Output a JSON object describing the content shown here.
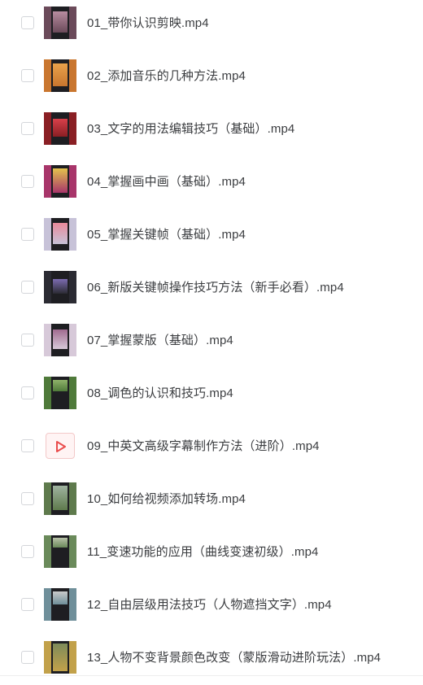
{
  "files": [
    {
      "name": "01_带你认识剪映.mp4",
      "icon": "video-thumbnail",
      "thumb_colors": [
        "#6b4a5a",
        "#b78ca0",
        "#2a1f28"
      ]
    },
    {
      "name": "02_添加音乐的几种方法.mp4",
      "icon": "video-thumbnail",
      "thumb_colors": [
        "#c9762f",
        "#e9a24b",
        "#7a3a1c"
      ]
    },
    {
      "name": "03_文字的用法编辑技巧（基础）.mp4",
      "icon": "video-thumbnail",
      "thumb_colors": [
        "#8a1f24",
        "#d8404a",
        "#222222"
      ]
    },
    {
      "name": "04_掌握画中画（基础）.mp4",
      "icon": "video-thumbnail",
      "thumb_colors": [
        "#a8356a",
        "#e4c24c",
        "#2a2a2a"
      ]
    },
    {
      "name": "05_掌握关键帧（基础）.mp4",
      "icon": "video-thumbnail",
      "thumb_colors": [
        "#c7c2d8",
        "#e98a9b",
        "#3c3c48"
      ]
    },
    {
      "name": "06_新版关键帧操作技巧方法（新手必看）.mp4",
      "icon": "video-thumbnail",
      "thumb_colors": [
        "#2b2b33",
        "#7c6bb0",
        "#111114"
      ]
    },
    {
      "name": "07_掌握蒙版（基础）.mp4",
      "icon": "video-thumbnail",
      "thumb_colors": [
        "#d7c9d9",
        "#a06a8f",
        "#1c1c1c"
      ]
    },
    {
      "name": "08_调色的认识和技巧.mp4",
      "icon": "video-thumbnail",
      "thumb_colors": [
        "#4f7a3a",
        "#8fb26a",
        "#1a1a1a"
      ]
    },
    {
      "name": "09_中英文高级字幕制作方法（进阶）.mp4",
      "icon": "video-file-icon",
      "thumb_colors": [
        "#fff4f4",
        "#ea4d4d",
        "#f3c9c9"
      ]
    },
    {
      "name": "10_如何给视频添加转场.mp4",
      "icon": "video-thumbnail",
      "thumb_colors": [
        "#5e7a4c",
        "#9fb3a0",
        "#2a2f2a"
      ]
    },
    {
      "name": "11_变速功能的应用（曲线变速初级）.mp4",
      "icon": "video-thumbnail",
      "thumb_colors": [
        "#6a8a5a",
        "#b9c2a9",
        "#151515"
      ]
    },
    {
      "name": "12_自由层级用法技巧（人物遮挡文字）.mp4",
      "icon": "video-thumbnail",
      "thumb_colors": [
        "#6f8f9a",
        "#c9c9c9",
        "#222222"
      ]
    },
    {
      "name": "13_人物不变背景颜色改变（蒙版滑动进阶玩法）.mp4",
      "icon": "video-thumbnail",
      "thumb_colors": [
        "#c2a14a",
        "#7e8b5a",
        "#3a3a2a"
      ]
    }
  ],
  "colors": {
    "text": "#3b3d40",
    "checkbox_border": "#d4d6da",
    "video_icon_red": "#ea4d4d"
  }
}
